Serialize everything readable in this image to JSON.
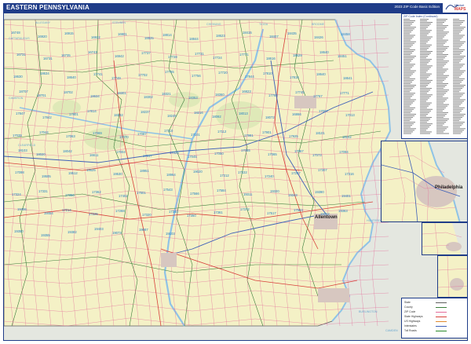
{
  "header": {
    "title": "EASTERN PENNSYLVANIA",
    "edition": "2023 ZIP Code Basic Edition",
    "logo_text_top": "Market",
    "logo_text_bottom": "MAPS",
    "colors": {
      "title_bar": "#1f3c88",
      "land": "#f4f1c6",
      "neighbor_land": "#e4e7e0",
      "water": "#a9d2ec",
      "county_border": "#3a7d3a",
      "zip_border": "#e46b9a",
      "highway": "#d8403a"
    }
  },
  "map": {
    "cities": [
      {
        "name": "Philadelphia"
      },
      {
        "name": "Allentown"
      }
    ],
    "map_labels": [
      "ALLEGANY",
      "STEUBEN",
      "CHEMUNG",
      "TIOGA",
      "BROOME",
      "CATTARAUGUS",
      "CAMERON",
      "CLEARFIELD",
      "HUNTERDON",
      "BURLINGTON",
      "CAMDEN"
    ],
    "zip_labels": [
      "16748",
      "16920",
      "16915",
      "16922",
      "16901",
      "18825",
      "18814",
      "18844",
      "18623",
      "18415",
      "18407",
      "18435",
      "18426",
      "18458",
      "16731",
      "16731",
      "16735",
      "16743",
      "16942",
      "17737",
      "17728",
      "17731",
      "17724",
      "17771",
      "18616",
      "18629",
      "18640",
      "18451",
      "18630",
      "18634",
      "18640",
      "17741",
      "17749",
      "17702",
      "17765",
      "17756",
      "17720",
      "17844",
      "17810",
      "17815",
      "18640",
      "18641",
      "18707",
      "18701",
      "18702",
      "18634",
      "18301",
      "18302",
      "18321",
      "18353",
      "18360",
      "16823",
      "17760",
      "17745",
      "17767",
      "17771",
      "17847",
      "17842",
      "17801",
      "17814",
      "18232",
      "18237",
      "18245",
      "18216",
      "18092",
      "18013",
      "18072",
      "16866",
      "17007",
      "17013",
      "17039",
      "17044",
      "17063",
      "17069",
      "17070",
      "17087",
      "17110",
      "17101",
      "17112",
      "17981",
      "17901",
      "17925",
      "18101",
      "18102",
      "18103",
      "18020",
      "18042",
      "16611",
      "17004",
      "17017",
      "17025",
      "17045",
      "17050",
      "17055",
      "17065",
      "17067",
      "17073",
      "17094",
      "17098",
      "19505",
      "19512",
      "19525",
      "19530",
      "18951",
      "18964",
      "19020",
      "17212",
      "17222",
      "17240",
      "17257",
      "17307",
      "17316",
      "17324",
      "17331",
      "17356",
      "17362",
      "17402",
      "17501",
      "17543",
      "17566",
      "17584",
      "19311",
      "19320",
      "19343",
      "19390",
      "19401",
      "19406",
      "19454",
      "17214",
      "17225",
      "17268",
      "17320",
      "17340",
      "17350",
      "17361",
      "17372",
      "17517",
      "17563",
      "19362",
      "19363",
      "19350",
      "19355",
      "19382",
      "19403",
      "19073",
      "19087",
      "19103"
    ]
  },
  "zip_index": {
    "title": "ZIP Code Index (Continued)"
  },
  "legend": {
    "entries": [
      "State",
      "County",
      "ZIP Code",
      "State Highways",
      "US Highways",
      "Interstates",
      "Toll Roads"
    ]
  },
  "inset": {
    "label": "Philadelphia"
  }
}
